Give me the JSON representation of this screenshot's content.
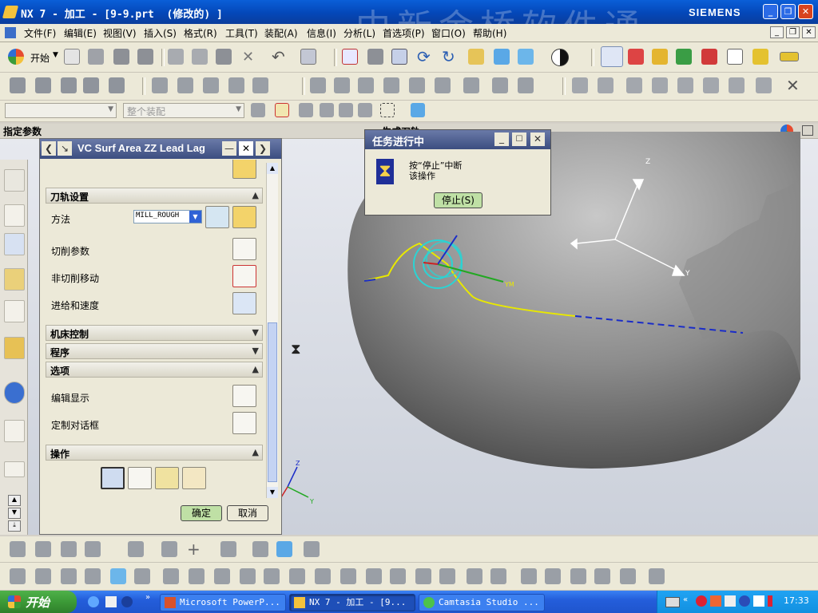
{
  "window": {
    "title": "NX 7 - 加工 - [9-9.prt  (修改的) ]",
    "brand": "SIEMENS",
    "watermark": "中新金桥软件通"
  },
  "menu": [
    "文件(F)",
    "编辑(E)",
    "视图(V)",
    "插入(S)",
    "格式(R)",
    "工具(T)",
    "装配(A)",
    "信息(I)",
    "分析(L)",
    "首选项(P)",
    "窗口(O)",
    "帮助(H)"
  ],
  "toolbar": {
    "start_label": "开始",
    "assembly_filter": "整个装配"
  },
  "status": {
    "prompt": "指定参数",
    "behind_title": "生成刀轨"
  },
  "dialog": {
    "title": "VC Surf Area ZZ Lead Lag",
    "sections": {
      "path": "刀轨设置",
      "machine": "机床控制",
      "program": "程序",
      "options": "选项",
      "actions": "操作"
    },
    "method_label": "方法",
    "method_value": "MILL_ROUGH",
    "cut_params": "切削参数",
    "non_cut": "非切削移动",
    "feeds": "进给和速度",
    "edit_display": "编辑显示",
    "custom_dialog": "定制对话框",
    "ok": "确定",
    "cancel": "取消"
  },
  "progress": {
    "title": "任务进行中",
    "message_line1": "按“停止”中断",
    "message_line2": "该操作",
    "stop": "停止(S)"
  },
  "viewport": {
    "axes": {
      "z": "Z",
      "y": "Y",
      "ym": "YM",
      "zc": "Z",
      "yc": "Y"
    }
  },
  "taskbar": {
    "start": "开始",
    "tasks": [
      "Microsoft PowerP...",
      "NX 7 - 加工 - [9...",
      "Camtasia Studio ..."
    ],
    "clock": "17:33"
  },
  "colors": {
    "titlebar": "#0a5fd8",
    "taskbar": "#245edb",
    "start": "#3c9a37",
    "toolpath": "#e8e800",
    "tool": "#2ad4d4"
  }
}
